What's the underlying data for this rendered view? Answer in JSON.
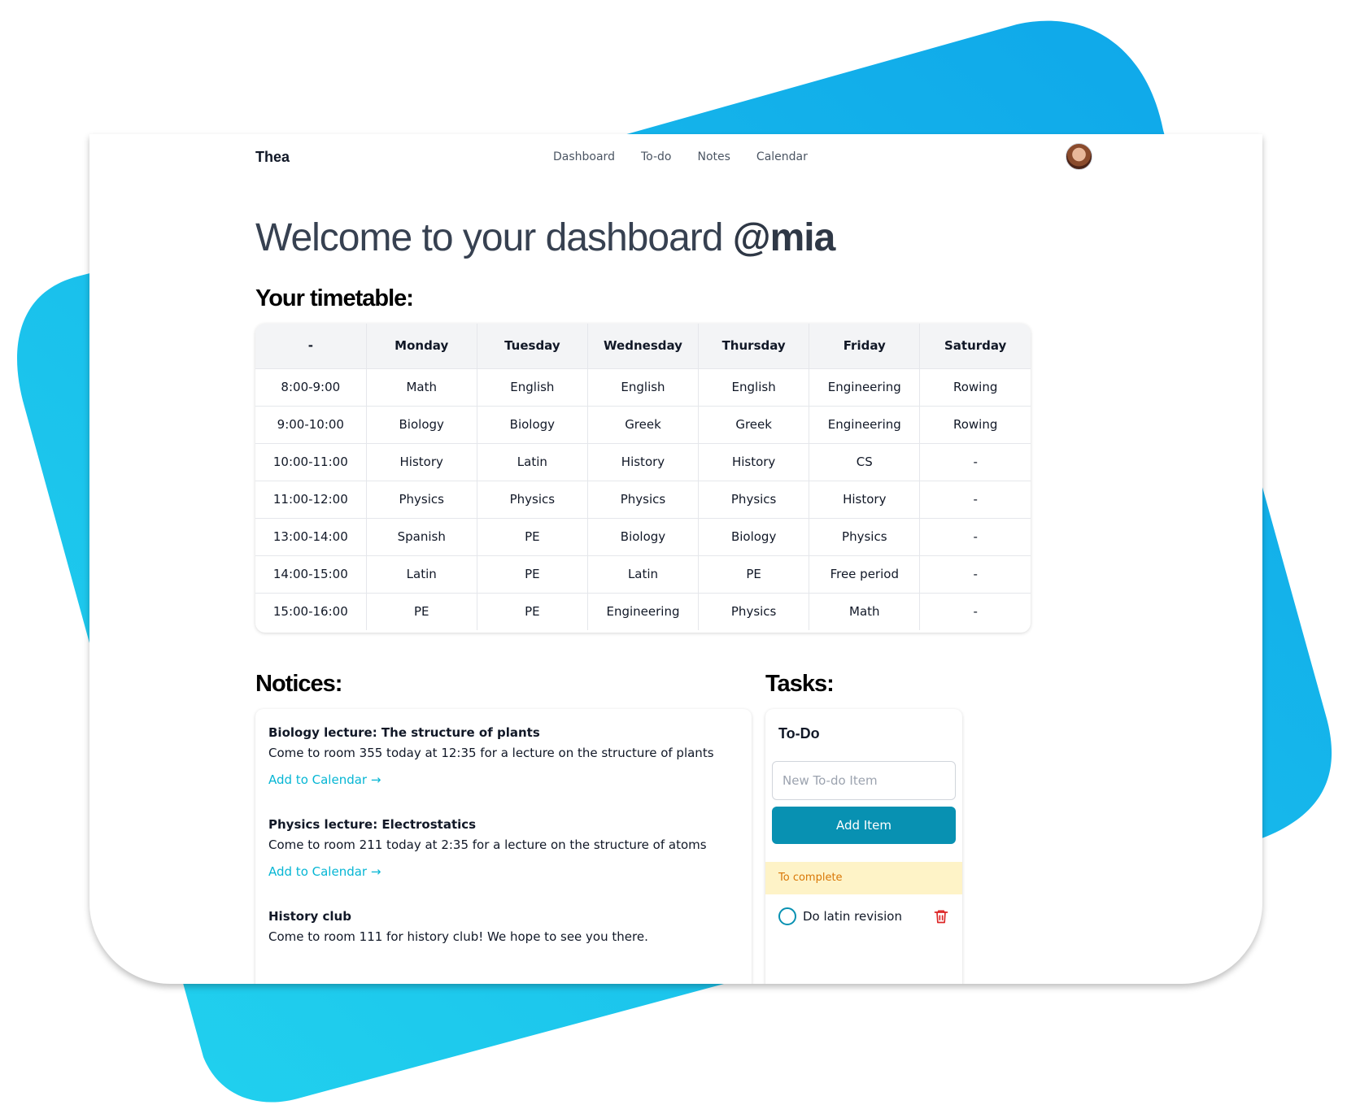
{
  "app": {
    "brand": "Thea"
  },
  "nav": {
    "items": [
      "Dashboard",
      "To-do",
      "Notes",
      "Calendar"
    ]
  },
  "user": {
    "handle": "@mia"
  },
  "welcome": {
    "prefix": "Welcome to your dashboard "
  },
  "timetable": {
    "title": "Your timetable:",
    "headers": [
      "-",
      "Monday",
      "Tuesday",
      "Wednesday",
      "Thursday",
      "Friday",
      "Saturday"
    ],
    "rows": [
      [
        "8:00-9:00",
        "Math",
        "English",
        "English",
        "English",
        "Engineering",
        "Rowing"
      ],
      [
        "9:00-10:00",
        "Biology",
        "Biology",
        "Greek",
        "Greek",
        "Engineering",
        "Rowing"
      ],
      [
        "10:00-11:00",
        "History",
        "Latin",
        "History",
        "History",
        "CS",
        "-"
      ],
      [
        "11:00-12:00",
        "Physics",
        "Physics",
        "Physics",
        "Physics",
        "History",
        "-"
      ],
      [
        "13:00-14:00",
        "Spanish",
        "PE",
        "Biology",
        "Biology",
        "Physics",
        "-"
      ],
      [
        "14:00-15:00",
        "Latin",
        "PE",
        "Latin",
        "PE",
        "Free period",
        "-"
      ],
      [
        "15:00-16:00",
        "PE",
        "PE",
        "Engineering",
        "Physics",
        "Math",
        "-"
      ]
    ]
  },
  "notices": {
    "title": "Notices:",
    "items": [
      {
        "title": "Biology lecture: The structure of plants",
        "body": "Come to room 355 today at 12:35 for a lecture on the structure of plants",
        "link": "Add to Calendar →"
      },
      {
        "title": "Physics lecture: Electrostatics",
        "body": "Come to room 211 today at 2:35 for a lecture on the structure of atoms",
        "link": "Add to Calendar →"
      },
      {
        "title": "History club",
        "body": "Come to room 111 for history club! We hope to see you there."
      }
    ]
  },
  "tasks": {
    "title": "Tasks:",
    "card_title": "To-Do",
    "input_placeholder": "New To-do Item",
    "add_button": "Add Item",
    "to_complete_label": "To complete",
    "items": [
      {
        "text": "Do latin revision"
      }
    ]
  },
  "colors": {
    "accent": "#0891b2",
    "link": "#06b6d4",
    "background_shape": "#0ea5e9",
    "to_complete_bg": "#fef3c7",
    "delete_icon": "#dc2626"
  },
  "icons": [
    "avatar",
    "circle-checkbox-icon",
    "trash-icon"
  ]
}
